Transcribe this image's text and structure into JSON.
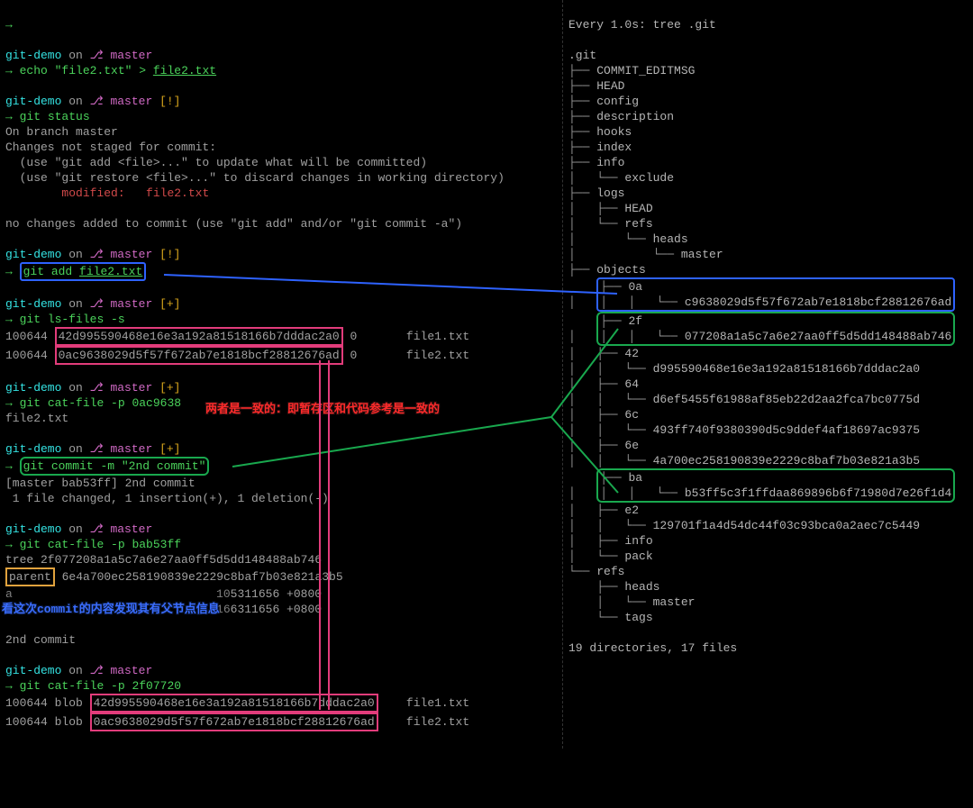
{
  "left": {
    "prompt_dir": "git-demo",
    "on": "on",
    "branch_icon": "⎇",
    "branch": "master",
    "flag_bang": "[!]",
    "flag_plus": "[+]",
    "cmd_echo": "echo \"file2.txt\" >",
    "cmd_echo_target": "file2.txt",
    "cmd_status": "git status",
    "status_branch": "On branch master",
    "status_line1": "Changes not staged for commit:",
    "status_line2": "  (use \"git add <file>...\" to update what will be committed)",
    "status_line3": "  (use \"git restore <file>...\" to discard changes in working directory)",
    "status_modified_label": "modified:",
    "status_modified_file": "file2.txt",
    "status_nochanges": "no changes added to commit (use \"git add\" and/or \"git commit -a\")",
    "cmd_add": "git add",
    "cmd_add_file": "file2.txt",
    "cmd_lsfiles": "git ls-files -s",
    "ls1_mode": "100644",
    "ls1_hash": "42d995590468e16e3a192a81518166b7dddac2a0",
    "ls1_stage": "0",
    "ls1_file": "file1.txt",
    "ls2_mode": "100644",
    "ls2_hash": "0ac9638029d5f57f672ab7e1818bcf28812676ad",
    "ls2_stage": "0",
    "ls2_file": "file2.txt",
    "cmd_catfile_0ac": "git cat-file -p 0ac9638",
    "catfile_0ac_out": "file2.txt",
    "cmd_commit": "git commit -m \"2nd commit\"",
    "commit_out1": "[master bab53ff] 2nd commit",
    "commit_out2": " 1 file changed, 1 insertion(+), 1 deletion(-)",
    "cmd_catfile_bab": "git cat-file -p bab53ff",
    "bab_tree": "tree 2f077208a1a5c7a6e27aa0ff5d5dd148488ab746",
    "bab_parent_label": "parent",
    "bab_parent_rest": " 6e4a700ec258190839e2229c8baf7b03e821a3b5",
    "bab_author_tail": "5311656 +0800",
    "bab_committer_tail": "6311656 +0800",
    "bab_msg": "2nd commit",
    "cmd_catfile_2f0": "git cat-file -p 2f07720",
    "tree1_mode": "100644 blob",
    "tree1_hash": "42d995590468e16e3a192a81518166b7dddac2a0",
    "tree1_file": "file1.txt",
    "tree2_mode": "100644 blob",
    "tree2_hash": "0ac9638029d5f57f672ab7e1818bcf28812676ad",
    "tree2_file": "file2.txt"
  },
  "right": {
    "watch_header": "Every 1.0s: tree .git",
    "root": ".git",
    "items": {
      "commit_editmsg": "COMMIT_EDITMSG",
      "head": "HEAD",
      "config": "config",
      "description": "description",
      "hooks": "hooks",
      "index": "index",
      "info": "info",
      "exclude": "exclude",
      "logs": "logs",
      "logs_head": "HEAD",
      "refs": "refs",
      "heads": "heads",
      "master": "master",
      "objects": "objects",
      "obj_0a": "0a",
      "obj_0a_h": "c9638029d5f57f672ab7e1818bcf28812676ad",
      "obj_2f": "2f",
      "obj_2f_h": "077208a1a5c7a6e27aa0ff5d5dd148488ab746",
      "obj_42": "42",
      "obj_42_h": "d995590468e16e3a192a81518166b7dddac2a0",
      "obj_64": "64",
      "obj_64_h": "d6ef5455f61988af85eb22d2aa2fca7bc0775d",
      "obj_6c": "6c",
      "obj_6c_h": "493ff740f9380390d5c9ddef4af18697ac9375",
      "obj_6e": "6e",
      "obj_6e_h": "4a700ec258190839e2229c8baf7b03e821a3b5",
      "obj_ba": "ba",
      "obj_ba_h": "b53ff5c3f1ffdaa869896b6f71980d7e26f1d4",
      "obj_e2": "e2",
      "obj_e2_h": "129701f1a4d54dc44f03c93bca0a2aec7c5449",
      "pack": "pack",
      "tags": "tags"
    },
    "summary": "19 directories, 17 files"
  },
  "annotations": {
    "red": "两者是一致的：即暂存区和代码参考是一致的",
    "blue": "看这次commit的内容发现其有父节点信息"
  }
}
